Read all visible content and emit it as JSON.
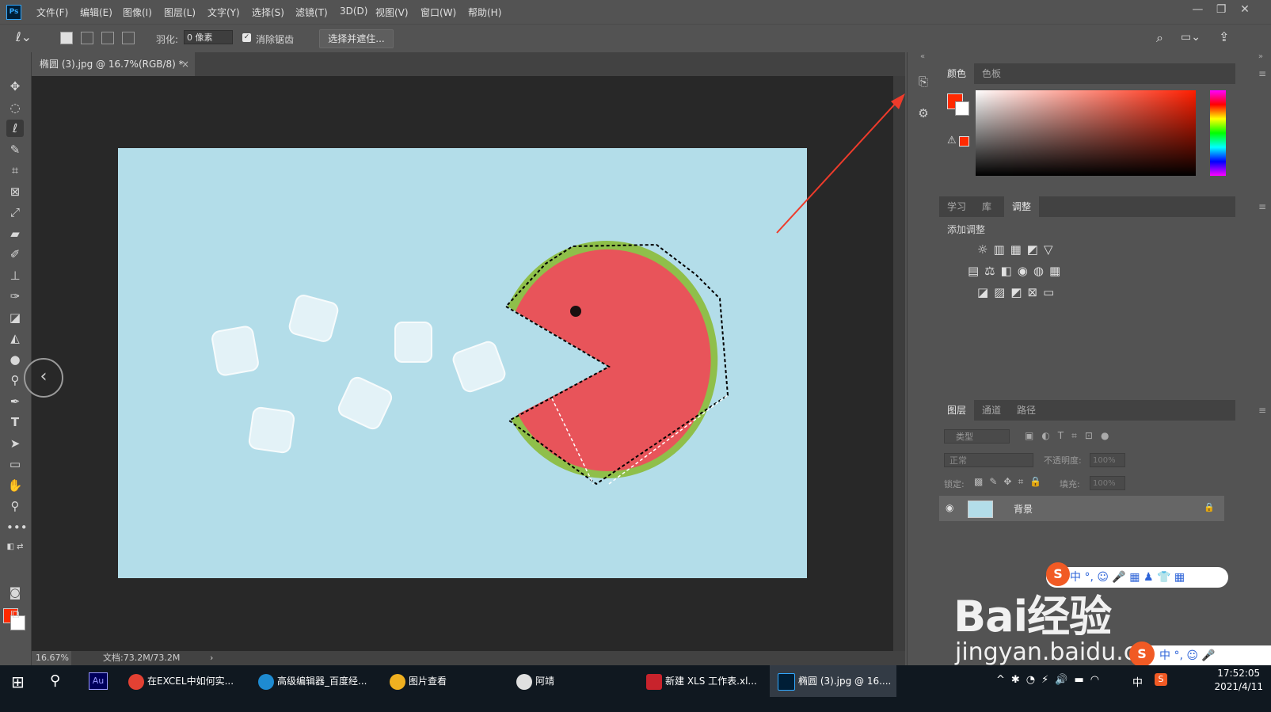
{
  "menubar": {
    "logo": "Ps",
    "items": [
      "文件(F)",
      "编辑(E)",
      "图像(I)",
      "图层(L)",
      "文字(Y)",
      "选择(S)",
      "滤镜(T)",
      "3D(D)",
      "视图(V)",
      "窗口(W)",
      "帮助(H)"
    ],
    "window_controls": [
      "—",
      "❐",
      "✕"
    ]
  },
  "options": {
    "feather_label": "羽化:",
    "feather_value": "0 像素",
    "antialias_label": "消除锯齿",
    "antialias_checked": true,
    "select_mask_button": "选择并遮住..."
  },
  "document": {
    "tab_title": "椭圆 (3).jpg @ 16.7%(RGB/8) *",
    "tab_close": "×",
    "zoom": "16.67%",
    "doc_info": "文档:73.2M/73.2M",
    "status_arrow": "›",
    "canvas_color": "#b3dde9"
  },
  "panels": {
    "color_tabs": [
      "颜色",
      "色板"
    ],
    "foreground_color": "#ff2a00",
    "background_color": "#ffffff",
    "adjust_tabs": [
      "学习",
      "库",
      "调整"
    ],
    "adjust_title": "添加调整",
    "layers_tabs": [
      "图层",
      "通道",
      "路径"
    ],
    "layers_search": "类型",
    "blend_mode": "正常",
    "opacity_label": "不透明度:",
    "opacity_value": "100%",
    "lock_label": "锁定:",
    "fill_label": "填充:",
    "fill_value": "100%",
    "layer_name": "背景"
  },
  "watermark": {
    "main": "Bai经验",
    "sub": "jingyan.baidu.com"
  },
  "ime": {
    "items": "中 °, ☺ 🎤 ▦ ♟ 👕 ▦",
    "items2": "中 °, ☺ 🎤"
  },
  "taskbar": {
    "items": [
      "在EXCEL中如何实...",
      "高级编辑器_百度经...",
      "图片查看",
      "阿靖",
      "新建 XLS 工作表.xl...",
      "椭圆 (3).jpg @ 16...."
    ],
    "tray_lang": "中",
    "time": "17:52:05",
    "date": "2021/4/11"
  }
}
